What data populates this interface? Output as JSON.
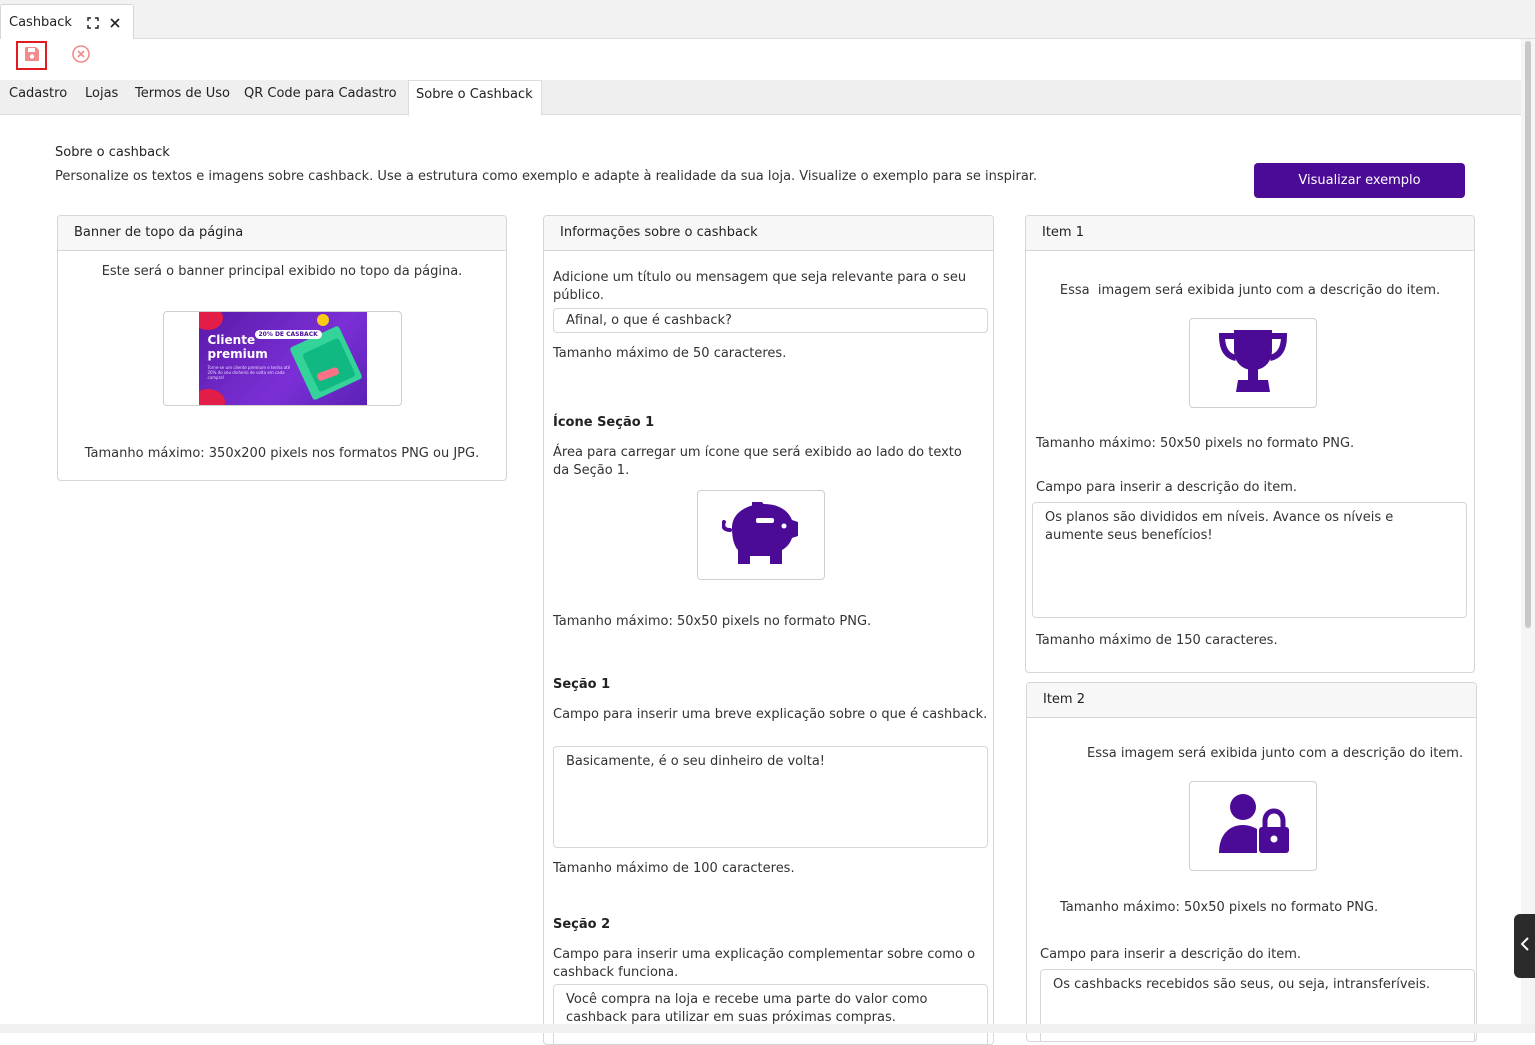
{
  "window_tab": {
    "title": "Cashback",
    "expand_icon": "expand-icon",
    "close_icon": "close-icon"
  },
  "toolbar": {
    "save_icon": "save-icon",
    "cancel_icon": "cancel-icon",
    "save_highlight_color": "#e01b24",
    "cancel_color": "#f28b8b"
  },
  "tabs": [
    {
      "label": "Cadastro"
    },
    {
      "label": "Lojas"
    },
    {
      "label": "Termos de Uso"
    },
    {
      "label": "QR Code para Cadastro"
    },
    {
      "label": "Sobre o Cashback",
      "active": true
    }
  ],
  "intro": {
    "title": "Sobre o cashback",
    "description": "Personalize os textos e imagens sobre cashback. Use a estrutura como exemplo e adapte à realidade da sua loja. Visualize o exemplo para se inspirar.",
    "preview_button": "Visualizar exemplo"
  },
  "banner_panel": {
    "title": "Banner de topo da página",
    "description": "Este será o banner principal exibido no topo da página.",
    "banner": {
      "badge": "20% DE CASBACK",
      "headline_line1": "Cliente",
      "headline_line2": "premium",
      "body": "Torne-se um cliente premium e tenha até 20% do seu dinheiro de volta em cada compra!"
    },
    "size_hint": "Tamanho máximo: 350x200 pixels nos formatos PNG ou JPG."
  },
  "info_panel": {
    "title": "Informações sobre o cashback",
    "title_help": "Adicione um título ou mensagem que seja relevante para o seu público.",
    "title_value": "Afinal, o que é cashback?",
    "title_limit": "Tamanho máximo de 50 caracteres.",
    "icon_section_label": "Ícone Seção 1",
    "icon_section_help": "Área para carregar um ícone que será exibido ao lado do texto da Seção 1.",
    "icon_section_icon": "piggy-bank-icon",
    "icon_size_hint": "Tamanho máximo: 50x50 pixels no formato PNG.",
    "section1_label": "Seção 1",
    "section1_help": "Campo para inserir uma breve explicação sobre o que é cashback.",
    "section1_value": "Basicamente, é o seu dinheiro de volta!",
    "section1_limit": "Tamanho máximo de 100 caracteres.",
    "section2_label": "Seção 2",
    "section2_help": "Campo para inserir uma explicação complementar sobre como o cashback funciona.",
    "section2_value": "Você compra na loja e recebe uma parte do valor como cashback para utilizar em suas próximas compras."
  },
  "item1": {
    "title": "Item 1",
    "image_help": "Essa  imagem será exibida junto com a descrição do item.",
    "icon": "trophy-icon",
    "size_hint": "Tamanho máximo: 50x50 pixels no formato PNG.",
    "desc_help": "Campo para inserir a descrição do item.",
    "desc_value": "Os planos são divididos em níveis. Avance os níveis e aumente seus benefícios!",
    "desc_limit": "Tamanho máximo de 150 caracteres."
  },
  "item2": {
    "title": "Item 2",
    "image_help": "Essa imagem será exibida junto com a descrição do item.",
    "icon": "user-lock-icon",
    "size_hint": "Tamanho máximo: 50x50 pixels no formato PNG.",
    "desc_help": "Campo para inserir a descrição do item.",
    "desc_value": "Os cashbacks recebidos são seus, ou seja, intransferíveis."
  },
  "theme": {
    "accent": "#4b0b96",
    "icon_color": "#4b0b96"
  },
  "side_handle_icon": "chevron-left-icon"
}
